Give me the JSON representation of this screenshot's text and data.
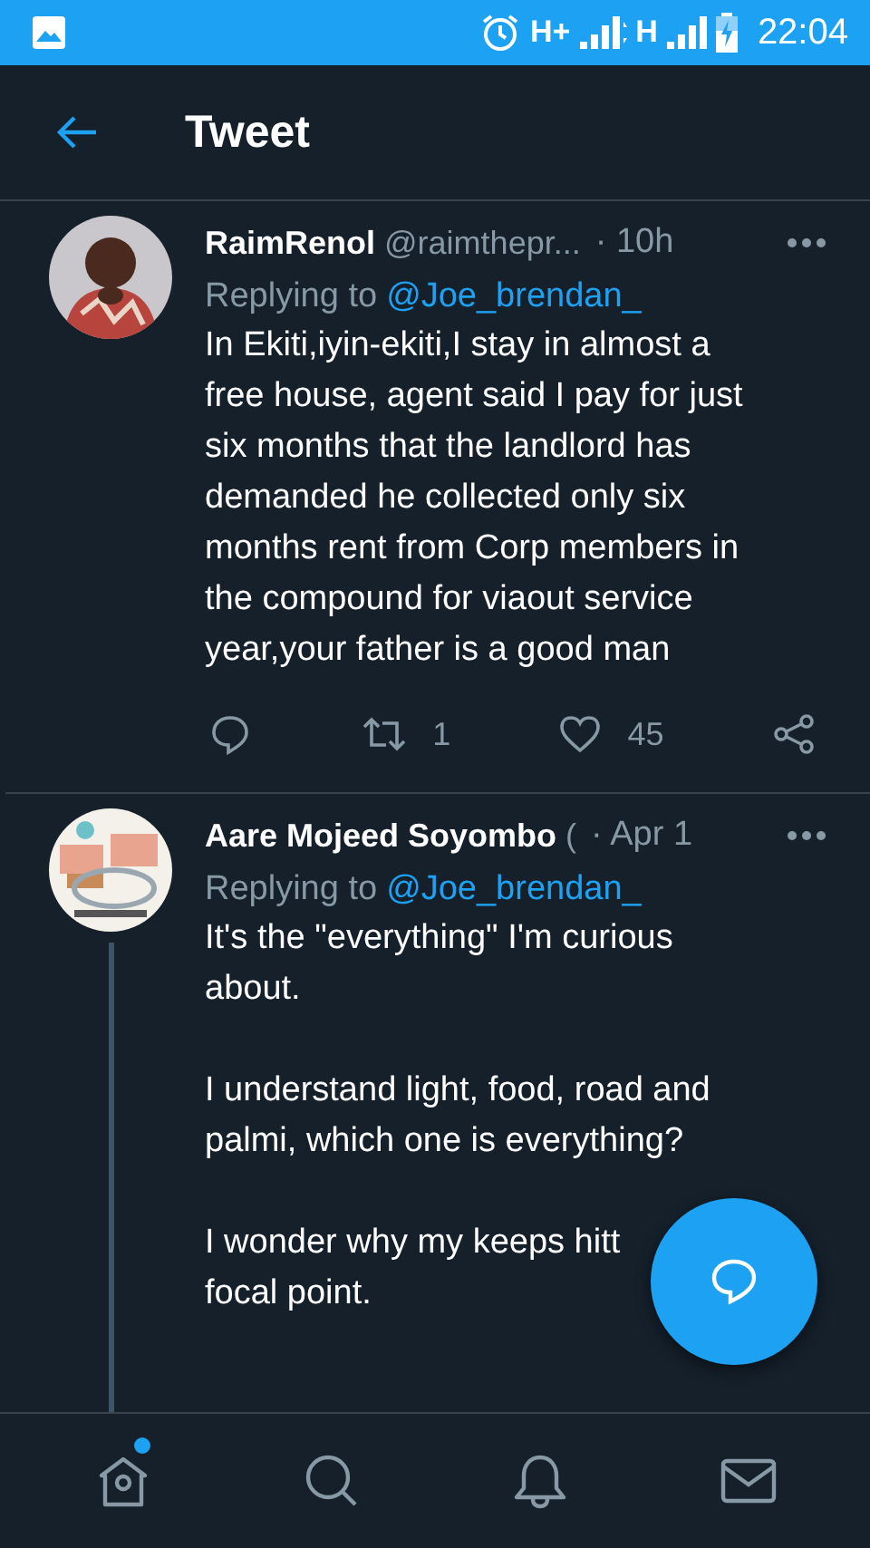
{
  "status_bar": {
    "network_1": "H+",
    "network_2": "H",
    "time": "22:04"
  },
  "header": {
    "title": "Tweet"
  },
  "tweets": [
    {
      "name": "RaimRenol",
      "handle": "@raimthepr...",
      "time": "· 10h",
      "replying_label": "Replying to",
      "replying_to": "@Joe_brendan_",
      "paragraphs": [
        [
          "In Ekiti,iyin-ekiti,I stay in almost a",
          "free house, agent said I pay for just",
          "six months that the landlord has",
          "demanded he collected only six",
          "months rent from Corp members in",
          "the compound for viaout service",
          "year,your father is a good man"
        ]
      ],
      "retweets": "1",
      "likes": "45",
      "thread_line": false
    },
    {
      "name": "Aare Mojeed Soyombo",
      "handle": "(",
      "time": "· Apr 1",
      "replying_label": "Replying to",
      "replying_to": "@Joe_brendan_",
      "paragraphs": [
        [
          "It's the \"everything\" I'm curious",
          "about."
        ],
        [
          "I understand light, food, road and",
          "palmi, which one is everything?"
        ],
        [
          "I wonder why my keeps hitt",
          "focal point."
        ]
      ],
      "thread_line": true
    }
  ],
  "bottom_nav": [
    {
      "kind": "home",
      "unread": true
    },
    {
      "kind": "search",
      "unread": false
    },
    {
      "kind": "notifications",
      "unread": false
    },
    {
      "kind": "messages",
      "unread": false
    }
  ]
}
